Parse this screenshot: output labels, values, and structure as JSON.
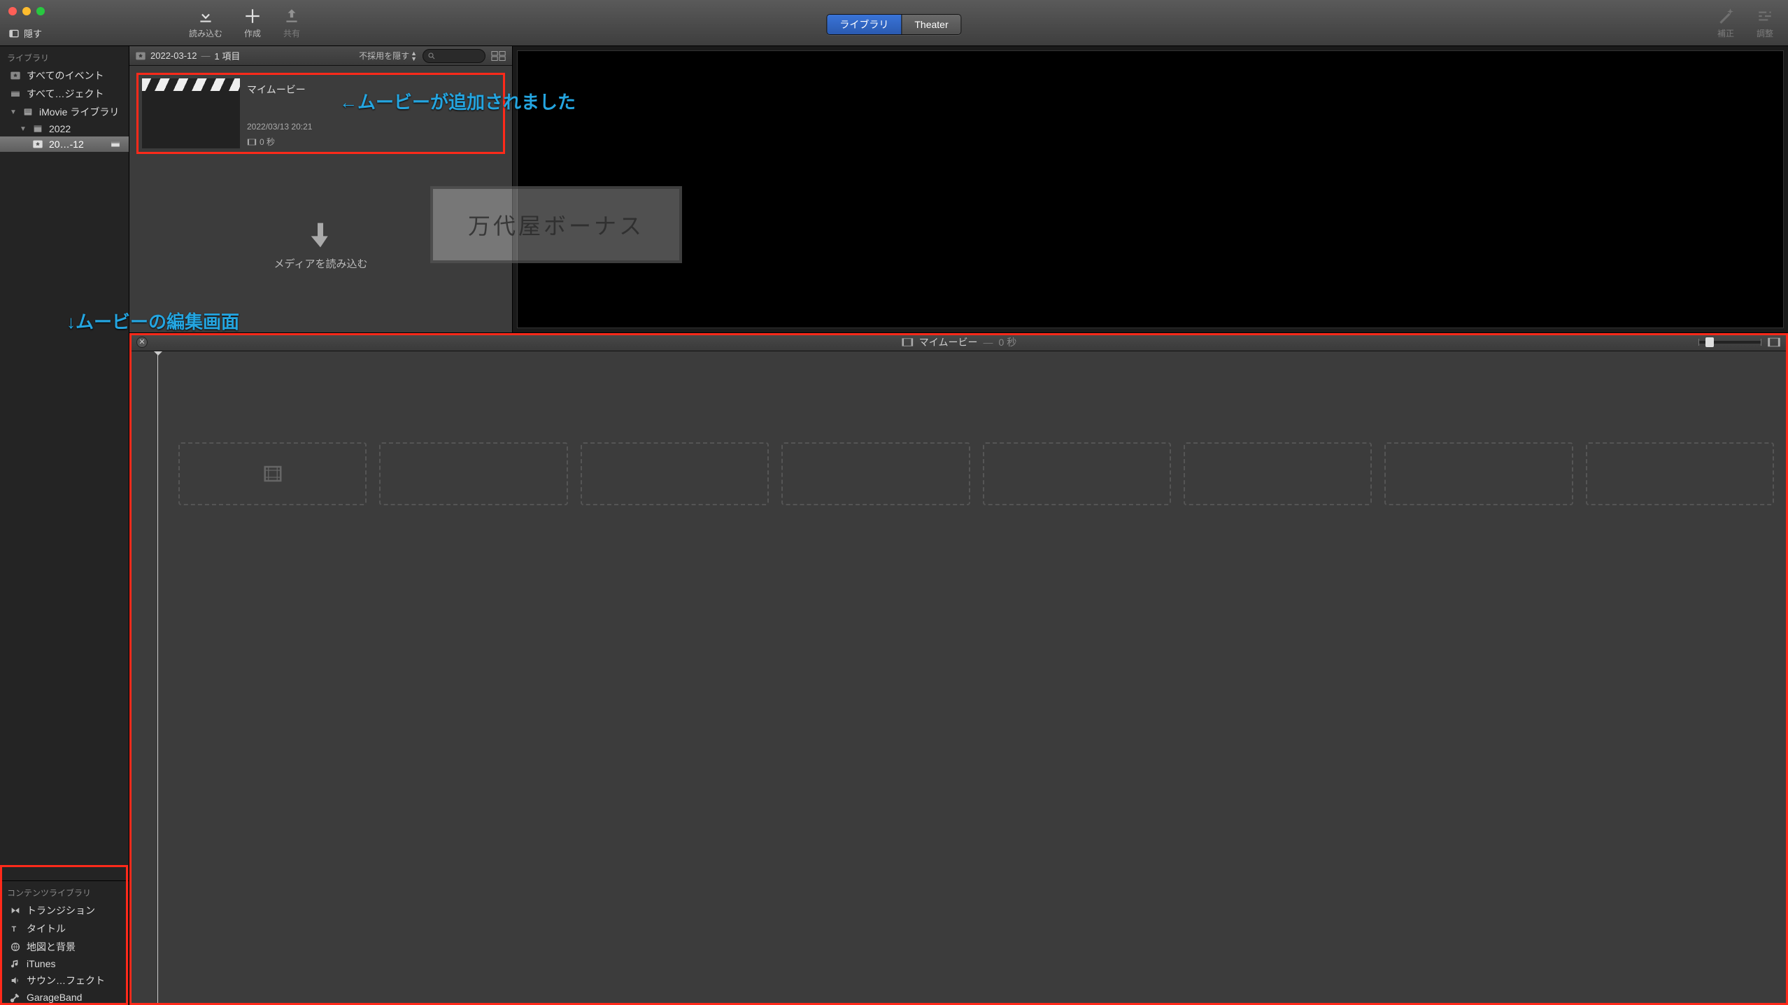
{
  "traffic_lights": {
    "close": "close",
    "min": "minimize",
    "max": "maximize"
  },
  "toolbar": {
    "hide_sidebar": "隠す",
    "import": "読み込む",
    "create": "作成",
    "share": "共有",
    "enhance": "補正",
    "adjust": "調整",
    "seg_library": "ライブラリ",
    "seg_theater": "Theater"
  },
  "sidebar": {
    "section_library": "ライブラリ",
    "all_events": "すべてのイベント",
    "all_projects": "すべて…ジェクト",
    "imovie_library": "iMovie ライブラリ",
    "year": "2022",
    "event_short": "20…-12",
    "section_content": "コンテンツライブラリ",
    "content": {
      "transitions": "トランジション",
      "titles": "タイトル",
      "maps": "地図と背景",
      "itunes": "iTunes",
      "sound_fx": "サウン…フェクト",
      "garageband": "GarageBand"
    }
  },
  "browser": {
    "header_event": "2022-03-12",
    "header_count": "1 項目",
    "hide_rejected": "不採用を隠す",
    "movie_title": "マイムービー",
    "movie_date": "2022/03/13 20:21",
    "movie_duration": "0 秒",
    "import_hint": "メディアを読み込む"
  },
  "timeline": {
    "title": "マイムービー",
    "duration": "0 秒"
  },
  "annotations": {
    "movie_added": "←ムービーが追加されました",
    "edit_area": "↓ムービーの編集画面",
    "ghost_text": "万代屋ボーナス"
  }
}
